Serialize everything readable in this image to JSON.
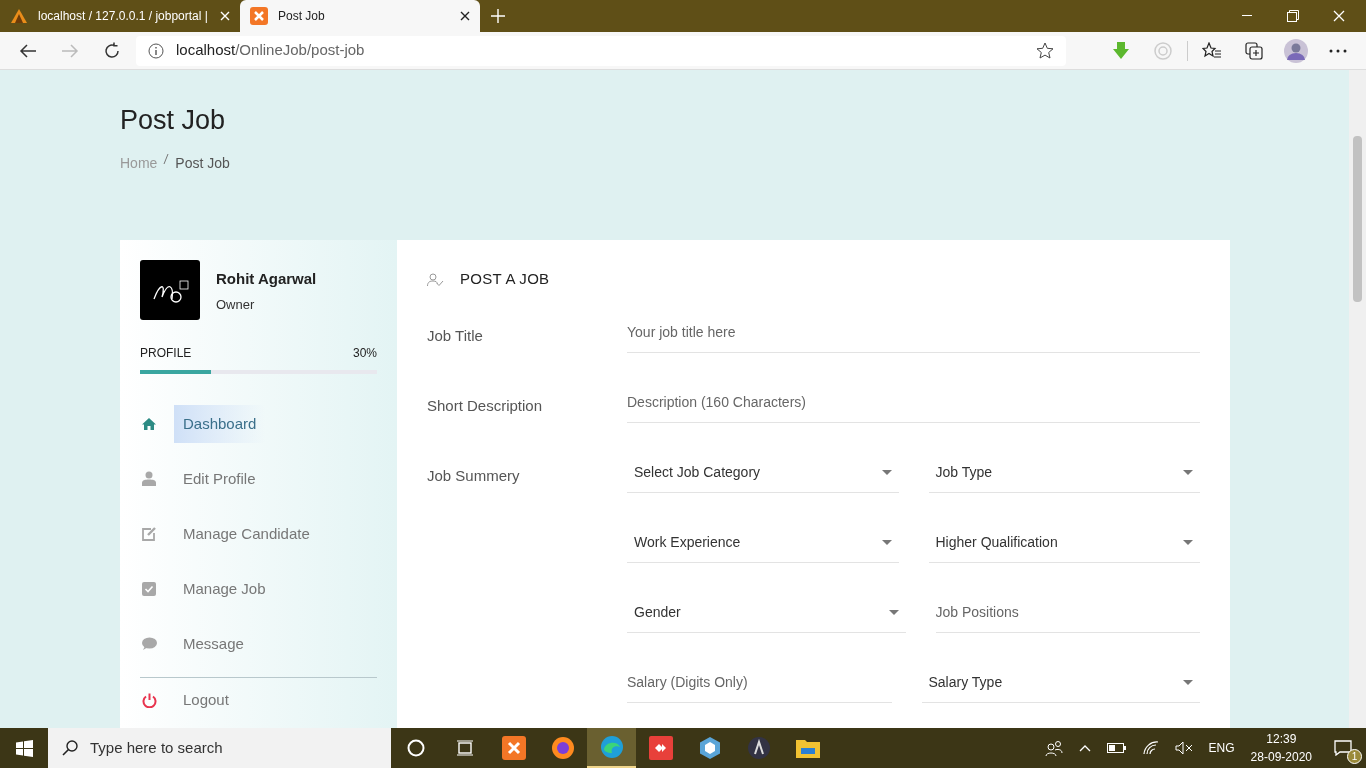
{
  "browser": {
    "tabs": [
      {
        "title": "localhost / 127.0.0.1 / jobportal |",
        "selected": false
      },
      {
        "title": "Post Job",
        "selected": true
      }
    ],
    "address": {
      "host": "localhost",
      "path": "/OnlineJob/post-job"
    }
  },
  "page": {
    "title": "Post Job",
    "breadcrumb": [
      {
        "label": "Home",
        "current": false
      },
      {
        "label": "Post Job",
        "current": true
      }
    ]
  },
  "profile": {
    "name": "Rohit Agarwal",
    "role": "Owner",
    "progress": {
      "label": "PROFILE",
      "reading": "30%",
      "level": 0.3
    },
    "menu": [
      {
        "label": "Dashboard",
        "selected": true
      },
      {
        "label": "Edit Profile",
        "selected": false
      },
      {
        "label": "Manage Candidate",
        "selected": false
      },
      {
        "label": "Manage Job",
        "selected": false
      },
      {
        "label": "Message",
        "selected": false
      }
    ],
    "logout": "Logout"
  },
  "form": {
    "heading": "POST A JOB",
    "rows": [
      {
        "label": "Job Title",
        "fields": [
          {
            "kind": "text",
            "placeholder": "Your job title here"
          }
        ]
      },
      {
        "label": "Short Description",
        "fields": [
          {
            "kind": "text",
            "placeholder": "Description (160 Characters)"
          }
        ]
      },
      {
        "label": "Job Summery",
        "fields": [
          {
            "kind": "select",
            "value": "Select Job Category"
          },
          {
            "kind": "select",
            "value": "Job Type"
          }
        ]
      },
      {
        "fields": [
          {
            "kind": "select",
            "value": "Work Experience"
          },
          {
            "kind": "select",
            "value": "Higher Qualification"
          }
        ]
      },
      {
        "fields": [
          {
            "kind": "select",
            "value": "Gender"
          },
          {
            "kind": "text",
            "placeholder": "Job Positions"
          }
        ]
      },
      {
        "fields": [
          {
            "kind": "text",
            "placeholder": "Salary (Digits Only)"
          },
          {
            "kind": "select",
            "value": "Salary Type"
          }
        ]
      }
    ]
  },
  "taskbar": {
    "search": {
      "placeholder": "Type here to search"
    },
    "language": "ENG",
    "time": "12:39",
    "date": "28-09-2020",
    "notifications": "1"
  }
}
